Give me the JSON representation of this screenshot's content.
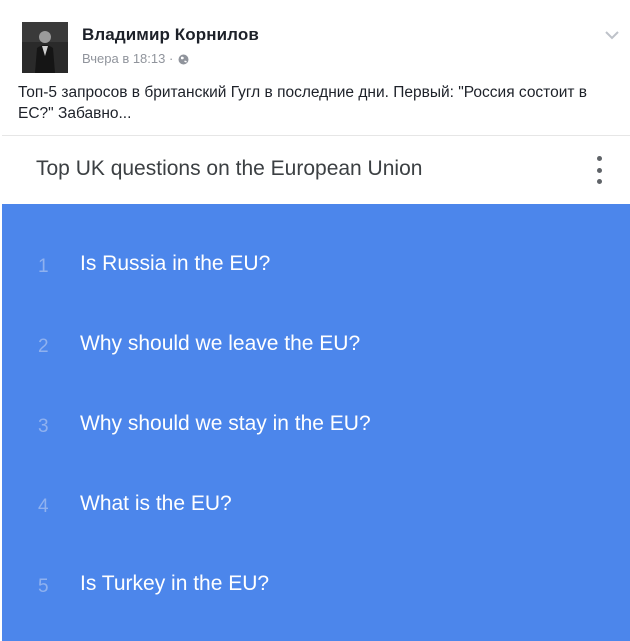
{
  "post": {
    "author": "Владимир Корнилов",
    "timestamp": "Вчера в 18:13 ·",
    "privacy_icon": "globe-icon",
    "menu_icon": "chevron-down-icon",
    "text": "Топ-5 запросов в британский Гугл в последние дни. Первый: \"Россия состоит в ЕС?\" Забавно..."
  },
  "card": {
    "title": "Top UK questions on the European Union",
    "menu_icon": "more-vert-icon",
    "accent_color": "#4c86eb",
    "items": [
      {
        "rank": "1",
        "question": "Is Russia in the EU?"
      },
      {
        "rank": "2",
        "question": "Why should we leave the EU?"
      },
      {
        "rank": "3",
        "question": "Why should we stay in the EU?"
      },
      {
        "rank": "4",
        "question": "What is the EU?"
      },
      {
        "rank": "5",
        "question": "Is Turkey in the EU?"
      }
    ]
  }
}
